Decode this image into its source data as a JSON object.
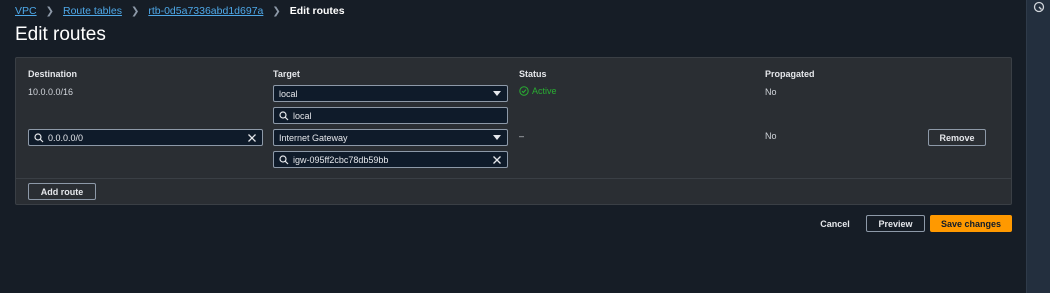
{
  "breadcrumb": {
    "items": [
      "VPC",
      "Route tables",
      "rtb-0d5a7336abd1d697a"
    ],
    "current": "Edit routes"
  },
  "page": {
    "title": "Edit routes"
  },
  "table": {
    "headers": {
      "destination": "Destination",
      "target": "Target",
      "status": "Status",
      "propagated": "Propagated"
    },
    "rows": [
      {
        "destination": "10.0.0.0/16",
        "target_type": "local",
        "target_value": "local",
        "status": "Active",
        "propagated": "No"
      },
      {
        "destination": "0.0.0.0/0",
        "target_type": "Internet Gateway",
        "target_value": "igw-095ff2cbc78db59bb",
        "status": "–",
        "propagated": "No",
        "remove_label": "Remove"
      }
    ]
  },
  "actions": {
    "add_route": "Add route",
    "cancel": "Cancel",
    "preview": "Preview",
    "save": "Save changes"
  },
  "colors": {
    "accent": "#ff9900",
    "link": "#4ea8e8",
    "status_active": "#29ad32"
  }
}
